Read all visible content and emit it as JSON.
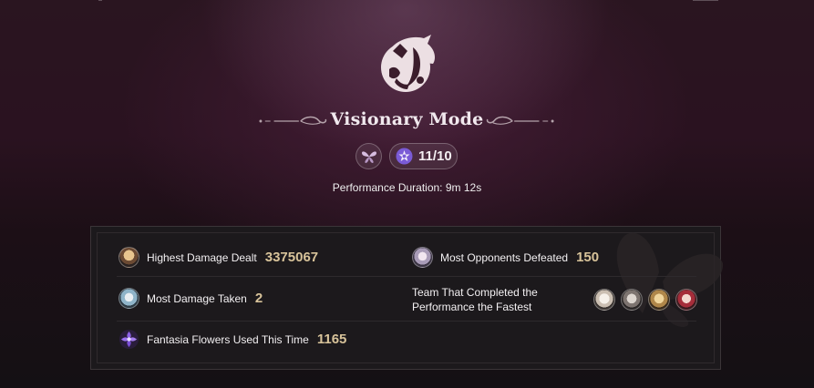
{
  "mode": {
    "title": "Visionary Mode",
    "icon": "butterfly-icon",
    "count_icon": "star-icon",
    "count": "11/10"
  },
  "performance": {
    "duration": "Performance Duration: 9m 12s"
  },
  "stats": {
    "highest_damage": {
      "label": "Highest Damage Dealt",
      "value": "3375067"
    },
    "most_opponents": {
      "label": "Most Opponents Defeated",
      "value": "150"
    },
    "most_damage_taken": {
      "label": "Most Damage Taken",
      "value": "2"
    },
    "fastest_team": {
      "label": "Team That Completed the Performance the Fastest"
    },
    "fantasia_flowers": {
      "label": "Fantasia Flowers Used This Time",
      "value": "1165"
    }
  },
  "colors": {
    "accent_gold": "#d8c39a",
    "panel_bg": "#1c191c",
    "badge_purple": "#7a5bd6"
  }
}
